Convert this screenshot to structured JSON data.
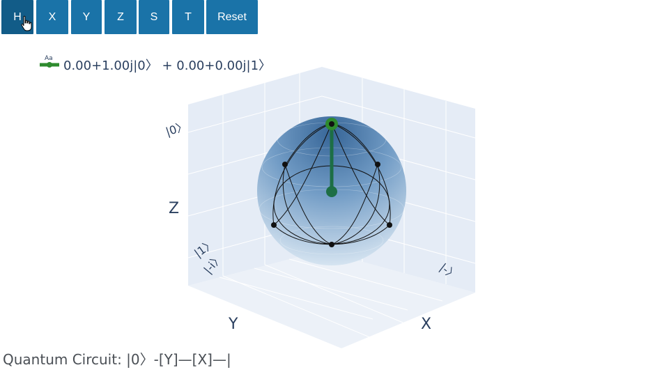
{
  "gates": {
    "items": [
      {
        "label": "H",
        "active": true
      },
      {
        "label": "X"
      },
      {
        "label": "Y"
      },
      {
        "label": "Z"
      },
      {
        "label": "S"
      },
      {
        "label": "T"
      },
      {
        "label": "Reset"
      }
    ]
  },
  "legend": {
    "icon_text": "Aa",
    "label": "0.00+1.00j|0〉 + 0.00+0.00j|1〉",
    "color": "#2e8b2e"
  },
  "scene": {
    "axis_titles": {
      "x": "X",
      "y": "Y",
      "z": "Z"
    },
    "basis_labels": {
      "zero": "|0〉",
      "one": "|1〉",
      "minus": "|-〉",
      "minus_i": "|-i〉"
    },
    "colors": {
      "sphere": "#4a7fb5",
      "vector": "#1d6e45",
      "tip": "#2e8b2e",
      "pane": "#e5ecf6"
    }
  },
  "circuit": {
    "text": "Quantum Circuit: |0〉-[Y]—[X]—|"
  }
}
